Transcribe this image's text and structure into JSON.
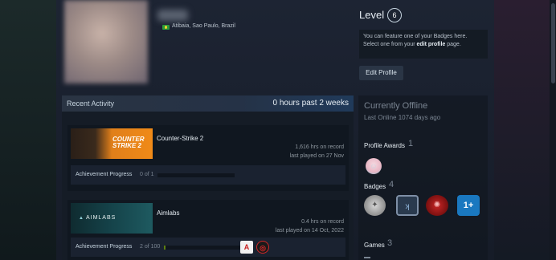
{
  "profile": {
    "location": "Atibaia, Sao Paulo, Brazil",
    "level_label": "Level",
    "level": "6",
    "badge_prompt_prefix": "You can feature one of your Badges here. Select one from your ",
    "badge_prompt_link": "edit profile",
    "badge_prompt_suffix": " page.",
    "edit_profile_label": "Edit Profile"
  },
  "recent_activity": {
    "title": "Recent Activity",
    "hours": "0 hours past 2 weeks",
    "games": [
      {
        "name": "Counter-Strike 2",
        "thumb_text": "COUNTER STRIKE 2",
        "hrs_on_record": "1,616 hrs on record",
        "last_played": "last played on 27 Nov",
        "achievement_label": "Achievement Progress",
        "achievement_count": "0 of 1",
        "achievement_fraction": 0.0
      },
      {
        "name": "Aimlabs",
        "thumb_text": "AIMLABS",
        "hrs_on_record": "0.4 hrs on record",
        "last_played": "last played on 14 Oct, 2022",
        "achievement_label": "Achievement Progress",
        "achievement_count": "2 of 100",
        "achievement_fraction": 0.02,
        "achievement_icons": [
          "aimlabs-logo-icon",
          "target-icon"
        ]
      }
    ]
  },
  "status": {
    "state": "Currently Offline",
    "last_online": "Last Online 1074 days ago",
    "profile_awards_label": "Profile Awards",
    "profile_awards_count": "1",
    "badges_label": "Badges",
    "badges_count": "4",
    "badge_four_text": "1+",
    "games_label": "Games",
    "games_count": "3"
  },
  "colors": {
    "accent_blue": "#1a78c0",
    "progress_green": "#5c7e10",
    "cs_orange": "#f08a18"
  }
}
